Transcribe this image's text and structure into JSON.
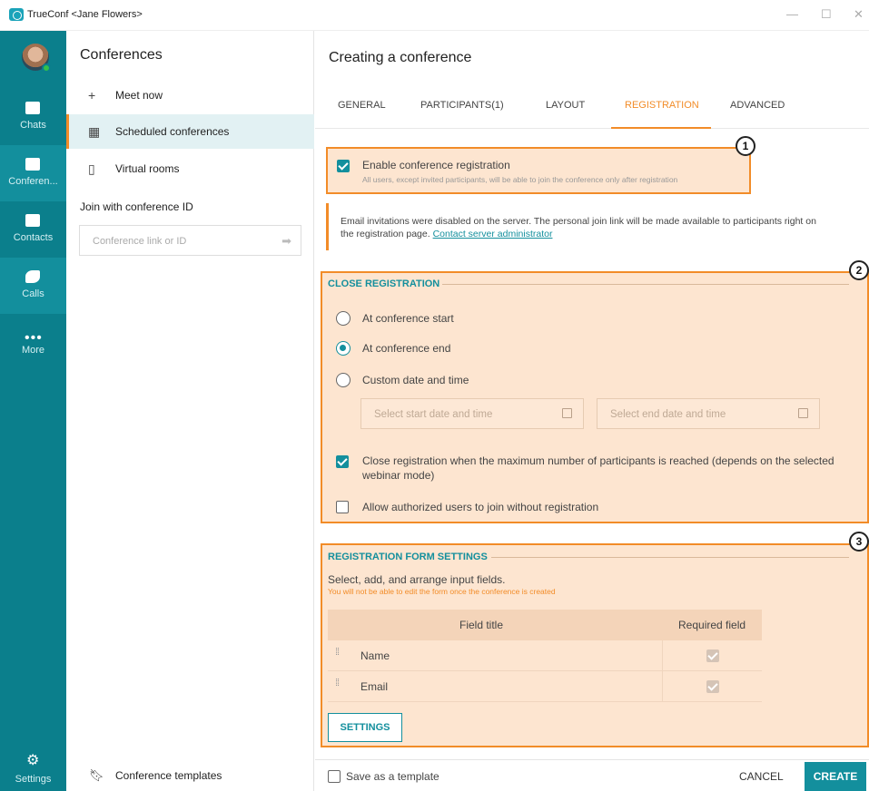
{
  "window": {
    "title": "TrueConf <Jane Flowers>"
  },
  "rail": {
    "items": [
      {
        "label": "Chats",
        "icon": "chat-icon"
      },
      {
        "label": "Conferen...",
        "icon": "conference-icon"
      },
      {
        "label": "Contacts",
        "icon": "contacts-icon"
      },
      {
        "label": "Calls",
        "icon": "phone-icon"
      },
      {
        "label": "More",
        "icon": "more-icon"
      }
    ],
    "settings_label": "Settings",
    "accent": "#0b7f8c"
  },
  "list": {
    "title": "Conferences",
    "items": [
      {
        "label": "Meet now",
        "icon": "plus-icon"
      },
      {
        "label": "Scheduled conferences",
        "icon": "calendar-icon"
      },
      {
        "label": "Virtual rooms",
        "icon": "door-icon"
      }
    ],
    "join_label": "Join with conference ID",
    "join_placeholder": "Conference link or ID",
    "templates_label": "Conference templates"
  },
  "main": {
    "title": "Creating a conference",
    "tabs": [
      "GENERAL",
      "PARTICIPANTS(1)",
      "LAYOUT",
      "REGISTRATION",
      "ADVANCED"
    ],
    "active_tab": "REGISTRATION",
    "badges": [
      "1",
      "2",
      "3"
    ],
    "enable": {
      "label": "Enable conference registration",
      "hint": "All users, except invited participants, will be able to join the conference only after registration",
      "checked": true
    },
    "notice": {
      "line1": "Email invitations were disabled on the server. The personal join link will be made available to participants right on",
      "line2": "the registration page.",
      "link": "Contact server administrator"
    },
    "close_registration": {
      "title": "CLOSE REGISTRATION",
      "options": [
        "At conference start",
        "At conference end",
        "Custom date and time"
      ],
      "selected": "At conference end",
      "start_placeholder": "Select start date and time",
      "end_placeholder": "Select end date and time",
      "max_line1": "Close registration when the maximum number of participants is reached (depends on the selected",
      "max_line2": "webinar mode)",
      "max_checked": true,
      "allow_label": "Allow authorized users to join without registration",
      "allow_checked": false
    },
    "form_settings": {
      "title": "REGISTRATION FORM SETTINGS",
      "desc": "Select, add, and arrange input fields.",
      "hint": "You will not be able to edit the form once the conference is created",
      "columns": [
        "Field title",
        "Required field"
      ],
      "rows": [
        {
          "field": "Name",
          "required": true
        },
        {
          "field": "Email",
          "required": true
        }
      ],
      "settings_button": "SETTINGS"
    },
    "footer": {
      "save_template": "Save as a template",
      "cancel": "CANCEL",
      "create": "CREATE"
    },
    "highlight_color": "#f28c28"
  }
}
